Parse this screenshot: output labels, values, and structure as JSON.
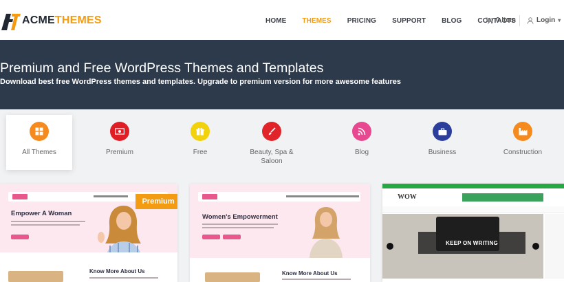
{
  "header": {
    "logo": {
      "part1": "ACME",
      "part2": "THEMES"
    },
    "nav": [
      {
        "label": "HOME",
        "active": false
      },
      {
        "label": "THEMES",
        "active": true
      },
      {
        "label": "PRICING",
        "active": false
      },
      {
        "label": "SUPPORT",
        "active": false
      },
      {
        "label": "BLOG",
        "active": false
      },
      {
        "label": "CONTACTS",
        "active": false
      }
    ],
    "cart_label": "0 Item",
    "login_label": "Login"
  },
  "hero": {
    "title": "Premium and Free WordPress Themes and Templates",
    "subtitle": "Download best free WordPress themes and templates. Upgrade to premium version for more awesome features"
  },
  "categories": [
    {
      "label": "All Themes",
      "icon": "grid-icon",
      "color": "#f58b1f",
      "active": true
    },
    {
      "label": "Premium",
      "icon": "money-icon",
      "color": "#e01e26",
      "active": false
    },
    {
      "label": "Free",
      "icon": "gift-icon",
      "color": "#f2d20c",
      "active": false
    },
    {
      "label": "Beauty, Spa & Saloon",
      "icon": "brush-icon",
      "color": "#e0242a",
      "active": false
    },
    {
      "label": "Blog",
      "icon": "rss-icon",
      "color": "#e8488f",
      "active": false
    },
    {
      "label": "Business",
      "icon": "briefcase-icon",
      "color": "#2c3e9c",
      "active": false
    },
    {
      "label": "Construction",
      "icon": "factory-icon",
      "color": "#f58b1f",
      "active": false
    }
  ],
  "cards": [
    {
      "heading": "Empower A Woman",
      "know_more": "Know More About Us",
      "badge": "Premium"
    },
    {
      "heading": "Women's Empowerment",
      "know_more": "Know More About Us"
    },
    {
      "logo": "WOW",
      "caption": "KEEP ON WRITING"
    }
  ],
  "colors": {
    "accent": "#f39c12",
    "hero_bg": "#2d3a4b",
    "brand_green": "#28a745"
  }
}
